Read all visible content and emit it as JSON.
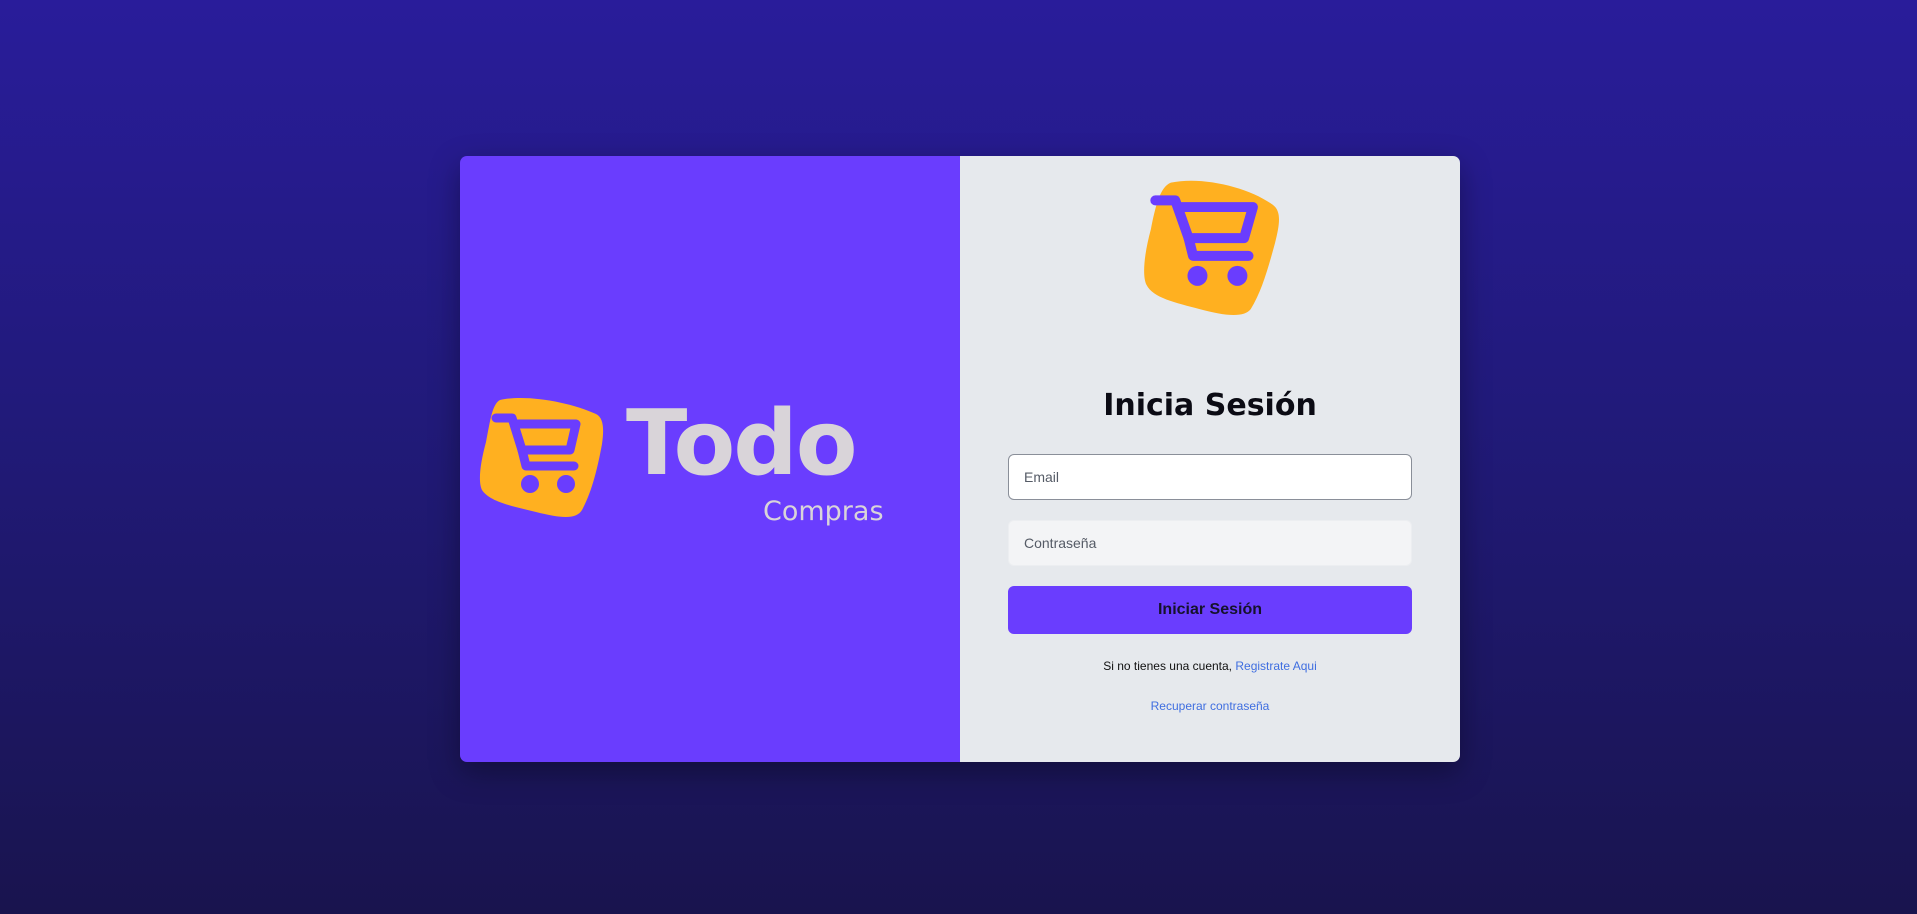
{
  "brand": {
    "name": "Todo",
    "subtitle": "Compras",
    "logo_icon": "shopping-cart-icon"
  },
  "login": {
    "title": "Inicia Sesión",
    "email_placeholder": "Email",
    "email_value": "",
    "password_placeholder": "Contraseña",
    "password_value": "",
    "submit_label": "Iniciar Sesión",
    "register_prefix": "Si no tienes una cuenta,",
    "register_link": "Registrate Aqui",
    "recover_link": "Recuperar contraseña"
  },
  "colors": {
    "primary": "#6a3dfe",
    "accent": "#ffb020",
    "panel": "#e6e9ed",
    "link": "#3f6ee0",
    "background_top": "#291c9a",
    "background_bottom": "#19144e"
  }
}
